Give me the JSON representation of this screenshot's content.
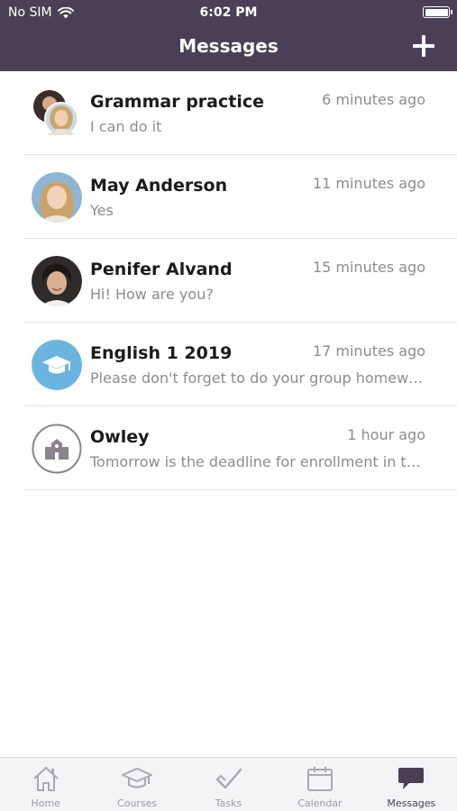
{
  "status_bar": {
    "carrier": "No SIM",
    "time": "6:02 PM"
  },
  "nav": {
    "title": "Messages",
    "compose_icon": "plus-icon"
  },
  "conversations": [
    {
      "title": "Grammar practice",
      "time": "6 minutes ago",
      "preview": "I can do it",
      "avatar": "group-photo-avatar"
    },
    {
      "title": "May Anderson",
      "time": "11 minutes ago",
      "preview": "Yes",
      "avatar": "photo-avatar"
    },
    {
      "title": "Penifer Alvand",
      "time": "15 minutes ago",
      "preview": "Hi! How are you?",
      "avatar": "photo-avatar"
    },
    {
      "title": "English 1 2019",
      "time": "17 minutes ago",
      "preview": "Please don't forget to do your group homework",
      "avatar": "graduation-cap-icon"
    },
    {
      "title": "Owley",
      "time": "1 hour ago",
      "preview": "Tomorrow is the deadline for enrollment in the courses",
      "avatar": "school-building-icon"
    }
  ],
  "tabbar": {
    "tabs": [
      {
        "label": "Home",
        "icon": "home-icon"
      },
      {
        "label": "Courses",
        "icon": "graduation-cap-icon"
      },
      {
        "label": "Tasks",
        "icon": "checkmark-icon"
      },
      {
        "label": "Calendar",
        "icon": "calendar-icon"
      },
      {
        "label": "Messages",
        "icon": "chat-bubble-icon",
        "active": true
      }
    ]
  },
  "colors": {
    "header_bg": "#4a3f57",
    "accent_blue": "#6cb4e0",
    "muted_text": "#8c8c92"
  }
}
